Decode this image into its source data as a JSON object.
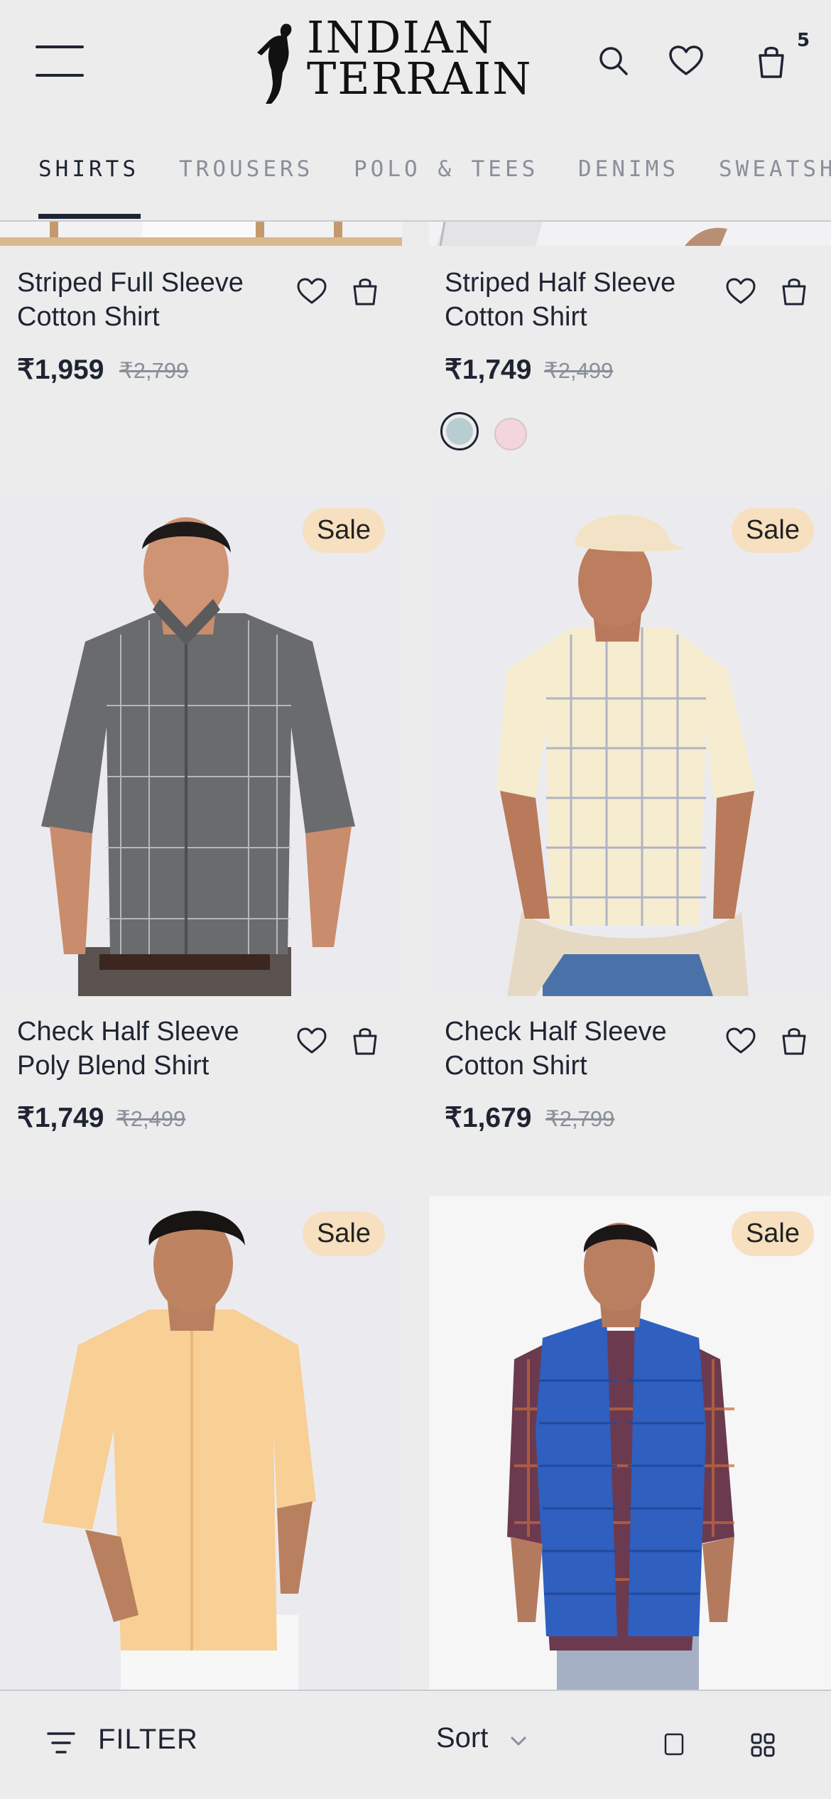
{
  "header": {
    "brand_line1": "INDIAN",
    "brand_line2": "TERRAIN",
    "cart_count": "5",
    "icons": [
      "menu-icon",
      "search-icon",
      "heart-icon",
      "bag-icon"
    ]
  },
  "tabs": [
    {
      "label": "SHIRTS",
      "active": true
    },
    {
      "label": "TROUSERS",
      "active": false
    },
    {
      "label": "POLO & TEES",
      "active": false
    },
    {
      "label": "DENIMS",
      "active": false
    },
    {
      "label": "SWEATSH",
      "active": false
    }
  ],
  "products": [
    {
      "name_line1": "Striped Full Sleeve",
      "name_line2": "Cotton Shirt",
      "price": "₹1,959",
      "mrp": "₹2,799",
      "sale": ""
    },
    {
      "name_line1": "Striped Half Sleeve",
      "name_line2": "Cotton Shirt",
      "price": "₹1,749",
      "mrp": "₹2,499",
      "sale": "",
      "swatches": [
        "#b8cdd0",
        "#f2d6dc"
      ]
    },
    {
      "name_line1": "Check Half Sleeve",
      "name_line2": "Poly Blend Shirt",
      "price": "₹1,749",
      "mrp": "₹2,499",
      "sale": "Sale"
    },
    {
      "name_line1": "Check Half Sleeve",
      "name_line2": "Cotton Shirt",
      "price": "₹1,679",
      "mrp": "₹2,799",
      "sale": "Sale"
    },
    {
      "sale": "Sale"
    },
    {
      "sale": "Sale"
    }
  ],
  "bottom_bar": {
    "filter_label": "FILTER",
    "sort_label": "Sort"
  },
  "colors": {
    "text": "#1f2433",
    "muted": "#8a8f9a",
    "background": "#ececec",
    "sale_badge": "#f6e0bf"
  }
}
